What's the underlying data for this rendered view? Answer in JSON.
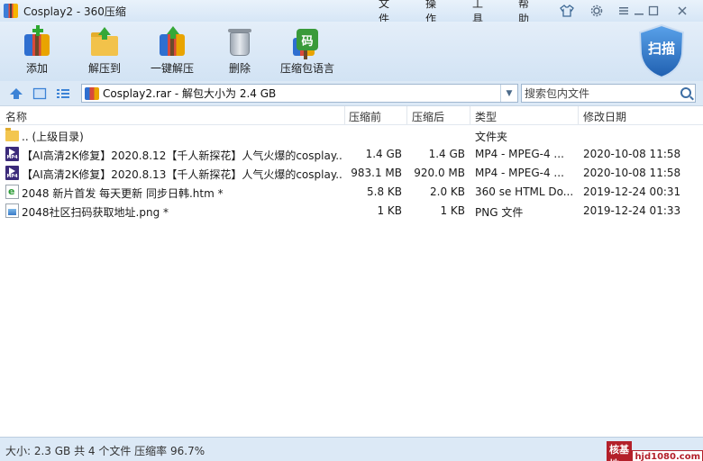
{
  "window": {
    "title": "Cosplay2 - 360压缩"
  },
  "menu": [
    "文件",
    "操作",
    "工具",
    "帮助"
  ],
  "toolbar": {
    "buttons": [
      {
        "label": "添加",
        "icon": "archive-add-icon"
      },
      {
        "label": "解压到",
        "icon": "extract-folder-icon"
      },
      {
        "label": "一键解压",
        "icon": "one-click-extract-icon"
      },
      {
        "label": "删除",
        "icon": "trash-icon"
      },
      {
        "label": "压缩包语言",
        "icon": "archive-language-icon",
        "glyph": "码"
      }
    ],
    "scan_label": "扫描"
  },
  "address": {
    "path": "Cosplay2.rar - 解包大小为 2.4 GB",
    "search_placeholder": "搜索包内文件"
  },
  "columns": [
    "名称",
    "压缩前",
    "压缩后",
    "类型",
    "修改日期"
  ],
  "files": [
    {
      "icon": "folder-icon",
      "name": ".. (上级目录)",
      "size": "",
      "packed": "",
      "type": "文件夹",
      "date": ""
    },
    {
      "icon": "mp4-file-icon",
      "name": "【AI高清2K修复】2020.8.12【千人新探花】人气火爆的cosplay...",
      "size": "1.4 GB",
      "packed": "1.4 GB",
      "type": "MP4 - MPEG-4 ...",
      "date": "2020-10-08 11:58"
    },
    {
      "icon": "mp4-file-icon",
      "name": "【AI高清2K修复】2020.8.13【千人新探花】人气火爆的cosplay...",
      "size": "983.1 MB",
      "packed": "920.0 MB",
      "type": "MP4 - MPEG-4 ...",
      "date": "2020-10-08 11:58"
    },
    {
      "icon": "html-file-icon",
      "name": "2048 新片首发 每天更新 同步日韩.htm *",
      "size": "5.8 KB",
      "packed": "2.0 KB",
      "type": "360 se HTML Do...",
      "date": "2019-12-24 00:31"
    },
    {
      "icon": "png-file-icon",
      "name": "2048社区扫码获取地址.png *",
      "size": "1 KB",
      "packed": "1 KB",
      "type": "PNG 文件",
      "date": "2019-12-24 01:33"
    }
  ],
  "status": {
    "text": "大小: 2.3 GB 共 4 个文件 压缩率 96.7%",
    "watermark_a": "核基地",
    "watermark_b": "hjd1080.com"
  },
  "colors": {
    "accent": "#2c6fc0",
    "background": "#dce9f6",
    "shield": "#2a6fc4"
  }
}
